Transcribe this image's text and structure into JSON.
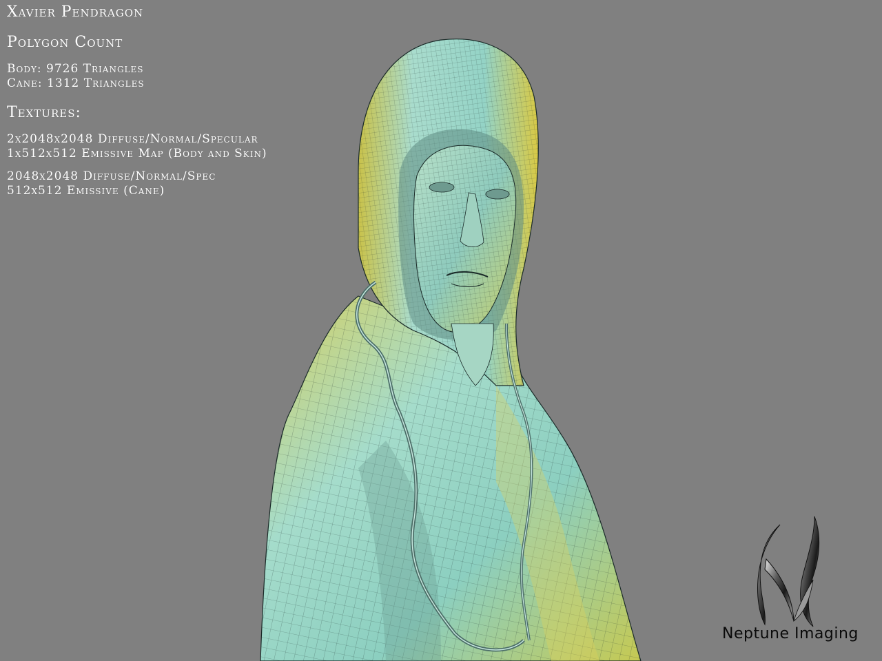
{
  "title": "Xavier Pendragon",
  "polygon_heading": "Polygon Count",
  "polygon": {
    "body": "Body: 9726 Triangles",
    "cane": "Cane: 1312 Triangles"
  },
  "textures_heading": "Textures:",
  "textures": {
    "body_line1": "2x2048x2048 Diffuse/Normal/Specular",
    "body_line2": "1x512x512 Emissive Map (Body and Skin)",
    "cane_line1": "2048x2048 Diffuse/Normal/Spec",
    "cane_line2": "512x512 Emissive (Cane)"
  },
  "brand": {
    "logo_icon": "neptune-ns-logo-icon",
    "name": "Neptune Imaging"
  },
  "colors": {
    "background": "#808080",
    "text": "#ffffff",
    "mesh_cyan": "#9fdcd0",
    "mesh_yellow": "#d8c84a",
    "wire": "#1a2a28"
  }
}
